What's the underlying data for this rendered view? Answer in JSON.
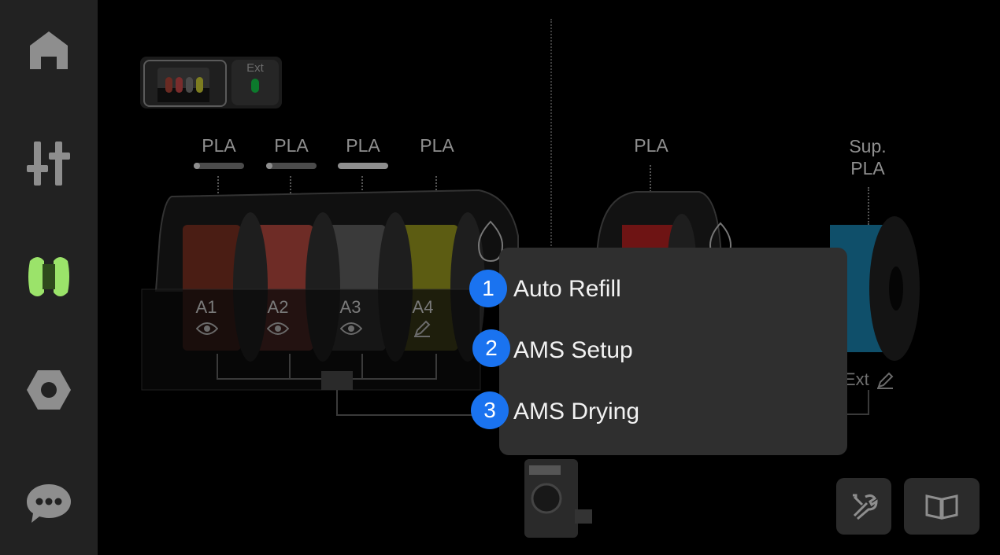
{
  "sidebar": {
    "items": [
      {
        "id": "home",
        "icon": "home-icon"
      },
      {
        "id": "controls",
        "icon": "sliders-icon"
      },
      {
        "id": "filament",
        "icon": "filament-spool-icon",
        "active": true
      },
      {
        "id": "settings",
        "icon": "hex-nut-icon"
      },
      {
        "id": "messages",
        "icon": "chat-bubble-icon"
      }
    ]
  },
  "unit_selector": {
    "ext_label": "Ext"
  },
  "ams": {
    "slots": [
      {
        "slot": "A1",
        "material": "PLA",
        "color": "#7a2a1c",
        "action_icon": "eye-icon"
      },
      {
        "slot": "A2",
        "material": "PLA",
        "color": "#9a3c34",
        "action_icon": "eye-icon"
      },
      {
        "slot": "A3",
        "material": "PLA",
        "color": "#555555",
        "action_icon": "eye-icon"
      },
      {
        "slot": "A4",
        "material": "PLA",
        "color": "#8a8a1a",
        "action_icon": "pencil-icon"
      }
    ]
  },
  "ht": {
    "material": "PLA",
    "color": "#a01c1c"
  },
  "external": {
    "material": "Sup. PLA",
    "label": "Ext",
    "color": "#0f4f6a"
  },
  "menu": {
    "items": [
      {
        "number": "1",
        "label": "Auto Refill"
      },
      {
        "number": "2",
        "label": "AMS Setup"
      },
      {
        "number": "3",
        "label": "AMS Drying"
      }
    ]
  },
  "toolbar": {
    "tools_icon": "wrench-screwdriver-icon",
    "guide_icon": "book-icon"
  },
  "colors": {
    "accent": "#9be36a",
    "badge": "#1a73f0",
    "menu_bg": "#2f2f2f"
  }
}
